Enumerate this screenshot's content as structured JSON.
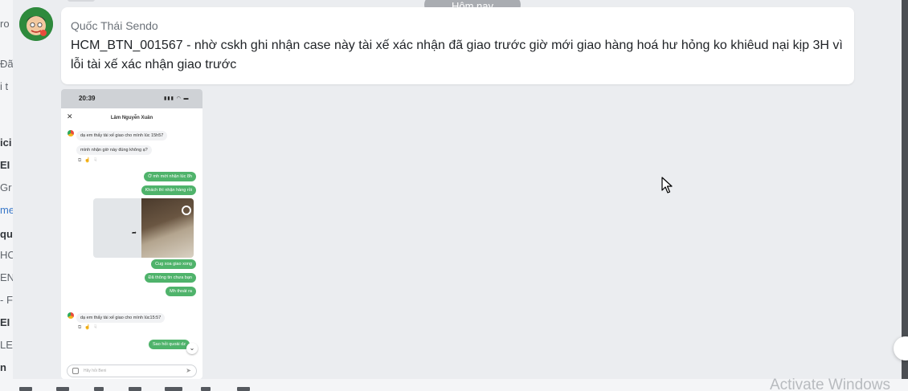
{
  "date_separator": "Hôm nay",
  "message": {
    "sender": "Quốc Thái Sendo",
    "text": "HCM_BTN_001567 - nhờ cskh ghi nhận case này tài xế xác nhận đã giao trước giờ mới giao hàng hoá hư hỏng ko khiêud nại kịp 3H vì lỗi tài xế xác nhận giao trước"
  },
  "attachment": {
    "status_time": "20:39",
    "chat_title": "Lâm Nguyễn Xuân",
    "incoming_1a": "dạ em thấy tài xế giao cho mình lúc 15h57",
    "incoming_1b": "mình nhận giờ này đúng không ạ?",
    "outgoing_1": "Ờ mh mới nhận lúc 8h",
    "outgoing_2": "Khách thì nhận hàng rồi",
    "outgoing_3": "Cug xoa giao xong",
    "outgoing_4": "Đã thông tin chưa bạn",
    "outgoing_5": "Mh thoát ra",
    "incoming_2": "dạ em thấy tài xế giao cho mình lúc15:57",
    "outgoing_6": "Sao hỏi quoài dz",
    "input_placeholder": "Hãy hỏi Beni"
  },
  "watermark": "Activate Windows"
}
